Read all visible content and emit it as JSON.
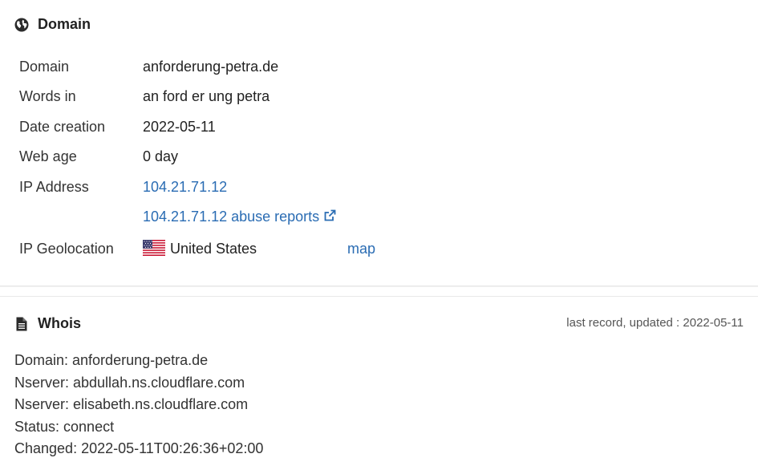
{
  "domain_section": {
    "title": "Domain",
    "icon": "globe-icon",
    "rows": [
      {
        "label": "Domain",
        "value": "anforderung-petra.de"
      },
      {
        "label": "Words in",
        "value": "an ford er ung petra"
      },
      {
        "label": "Date creation",
        "value": "2022-05-11"
      },
      {
        "label": "Web age",
        "value": "0 day"
      },
      {
        "label": "IP Address",
        "value": "104.21.71.12"
      }
    ],
    "abuse_link": "104.21.71.12 abuse reports",
    "geolocation": {
      "label": "IP Geolocation",
      "country": "United States",
      "flag_icon": "us-flag-icon",
      "map_link": "map"
    },
    "link_color": "#2a6cb3"
  },
  "whois_section": {
    "title": "Whois",
    "icon": "document-icon",
    "updated": "last record, updated : 2022-05-11",
    "lines": [
      "Domain: anforderung-petra.de",
      "Nserver: abdullah.ns.cloudflare.com",
      "Nserver: elisabeth.ns.cloudflare.com",
      "Status: connect",
      "Changed: 2022-05-11T00:26:36+02:00"
    ]
  }
}
